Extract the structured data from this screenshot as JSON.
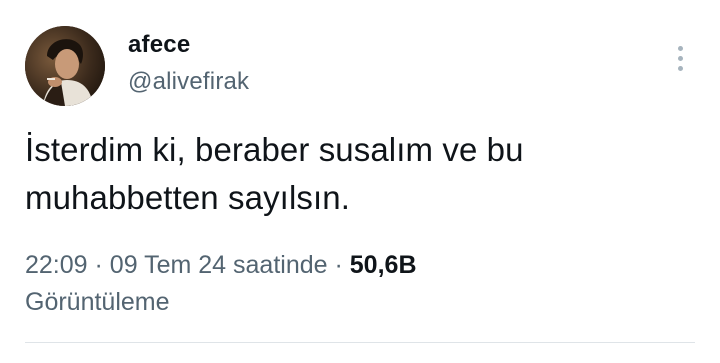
{
  "author": {
    "display_name": "afece",
    "handle": "@alivefirak"
  },
  "tweet": {
    "text_lines": [
      "İsterdim ki, beraber susalım ve bu",
      "muhabbetten sayılsın."
    ]
  },
  "meta": {
    "time": "22:09",
    "separator": "·",
    "date": "09 Tem 24 saatinde",
    "views_count": "50,6B",
    "views_label": "Görüntüleme"
  },
  "colors": {
    "text_primary": "#0f1419",
    "text_secondary": "#536471",
    "icon_muted": "#a7b4be"
  },
  "icons": {
    "more": "more-vertical-icon"
  }
}
